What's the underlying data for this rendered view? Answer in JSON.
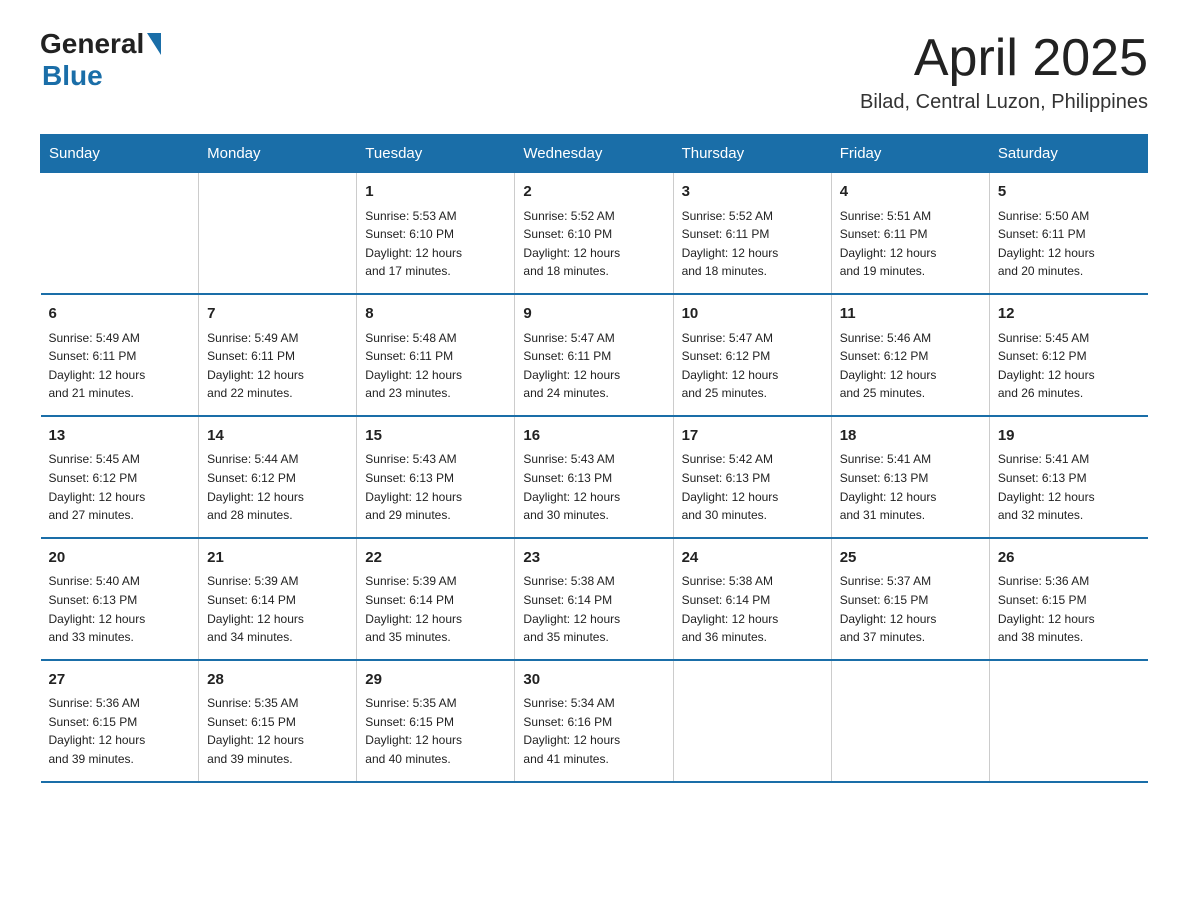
{
  "header": {
    "logo_general": "General",
    "logo_blue": "Blue",
    "month_year": "April 2025",
    "location": "Bilad, Central Luzon, Philippines"
  },
  "weekdays": [
    "Sunday",
    "Monday",
    "Tuesday",
    "Wednesday",
    "Thursday",
    "Friday",
    "Saturday"
  ],
  "weeks": [
    [
      {
        "day": "",
        "info": ""
      },
      {
        "day": "",
        "info": ""
      },
      {
        "day": "1",
        "info": "Sunrise: 5:53 AM\nSunset: 6:10 PM\nDaylight: 12 hours\nand 17 minutes."
      },
      {
        "day": "2",
        "info": "Sunrise: 5:52 AM\nSunset: 6:10 PM\nDaylight: 12 hours\nand 18 minutes."
      },
      {
        "day": "3",
        "info": "Sunrise: 5:52 AM\nSunset: 6:11 PM\nDaylight: 12 hours\nand 18 minutes."
      },
      {
        "day": "4",
        "info": "Sunrise: 5:51 AM\nSunset: 6:11 PM\nDaylight: 12 hours\nand 19 minutes."
      },
      {
        "day": "5",
        "info": "Sunrise: 5:50 AM\nSunset: 6:11 PM\nDaylight: 12 hours\nand 20 minutes."
      }
    ],
    [
      {
        "day": "6",
        "info": "Sunrise: 5:49 AM\nSunset: 6:11 PM\nDaylight: 12 hours\nand 21 minutes."
      },
      {
        "day": "7",
        "info": "Sunrise: 5:49 AM\nSunset: 6:11 PM\nDaylight: 12 hours\nand 22 minutes."
      },
      {
        "day": "8",
        "info": "Sunrise: 5:48 AM\nSunset: 6:11 PM\nDaylight: 12 hours\nand 23 minutes."
      },
      {
        "day": "9",
        "info": "Sunrise: 5:47 AM\nSunset: 6:11 PM\nDaylight: 12 hours\nand 24 minutes."
      },
      {
        "day": "10",
        "info": "Sunrise: 5:47 AM\nSunset: 6:12 PM\nDaylight: 12 hours\nand 25 minutes."
      },
      {
        "day": "11",
        "info": "Sunrise: 5:46 AM\nSunset: 6:12 PM\nDaylight: 12 hours\nand 25 minutes."
      },
      {
        "day": "12",
        "info": "Sunrise: 5:45 AM\nSunset: 6:12 PM\nDaylight: 12 hours\nand 26 minutes."
      }
    ],
    [
      {
        "day": "13",
        "info": "Sunrise: 5:45 AM\nSunset: 6:12 PM\nDaylight: 12 hours\nand 27 minutes."
      },
      {
        "day": "14",
        "info": "Sunrise: 5:44 AM\nSunset: 6:12 PM\nDaylight: 12 hours\nand 28 minutes."
      },
      {
        "day": "15",
        "info": "Sunrise: 5:43 AM\nSunset: 6:13 PM\nDaylight: 12 hours\nand 29 minutes."
      },
      {
        "day": "16",
        "info": "Sunrise: 5:43 AM\nSunset: 6:13 PM\nDaylight: 12 hours\nand 30 minutes."
      },
      {
        "day": "17",
        "info": "Sunrise: 5:42 AM\nSunset: 6:13 PM\nDaylight: 12 hours\nand 30 minutes."
      },
      {
        "day": "18",
        "info": "Sunrise: 5:41 AM\nSunset: 6:13 PM\nDaylight: 12 hours\nand 31 minutes."
      },
      {
        "day": "19",
        "info": "Sunrise: 5:41 AM\nSunset: 6:13 PM\nDaylight: 12 hours\nand 32 minutes."
      }
    ],
    [
      {
        "day": "20",
        "info": "Sunrise: 5:40 AM\nSunset: 6:13 PM\nDaylight: 12 hours\nand 33 minutes."
      },
      {
        "day": "21",
        "info": "Sunrise: 5:39 AM\nSunset: 6:14 PM\nDaylight: 12 hours\nand 34 minutes."
      },
      {
        "day": "22",
        "info": "Sunrise: 5:39 AM\nSunset: 6:14 PM\nDaylight: 12 hours\nand 35 minutes."
      },
      {
        "day": "23",
        "info": "Sunrise: 5:38 AM\nSunset: 6:14 PM\nDaylight: 12 hours\nand 35 minutes."
      },
      {
        "day": "24",
        "info": "Sunrise: 5:38 AM\nSunset: 6:14 PM\nDaylight: 12 hours\nand 36 minutes."
      },
      {
        "day": "25",
        "info": "Sunrise: 5:37 AM\nSunset: 6:15 PM\nDaylight: 12 hours\nand 37 minutes."
      },
      {
        "day": "26",
        "info": "Sunrise: 5:36 AM\nSunset: 6:15 PM\nDaylight: 12 hours\nand 38 minutes."
      }
    ],
    [
      {
        "day": "27",
        "info": "Sunrise: 5:36 AM\nSunset: 6:15 PM\nDaylight: 12 hours\nand 39 minutes."
      },
      {
        "day": "28",
        "info": "Sunrise: 5:35 AM\nSunset: 6:15 PM\nDaylight: 12 hours\nand 39 minutes."
      },
      {
        "day": "29",
        "info": "Sunrise: 5:35 AM\nSunset: 6:15 PM\nDaylight: 12 hours\nand 40 minutes."
      },
      {
        "day": "30",
        "info": "Sunrise: 5:34 AM\nSunset: 6:16 PM\nDaylight: 12 hours\nand 41 minutes."
      },
      {
        "day": "",
        "info": ""
      },
      {
        "day": "",
        "info": ""
      },
      {
        "day": "",
        "info": ""
      }
    ]
  ]
}
